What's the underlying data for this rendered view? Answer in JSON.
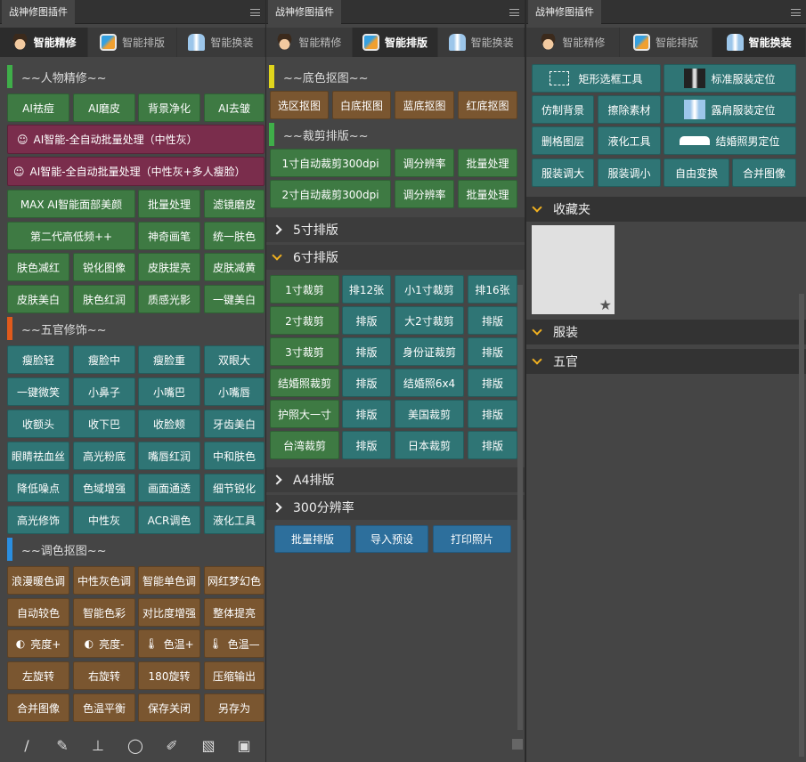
{
  "panel_title": "战神修图插件",
  "tabs": [
    "智能精修",
    "智能排版",
    "智能换装"
  ],
  "p1": {
    "sec1": "~~人物精修~~",
    "row1": [
      "AI祛痘",
      "AI磨皮",
      "背景净化",
      "AI去皱"
    ],
    "ai1": "AI智能-全自动批量处理（中性灰）",
    "ai2": "AI智能-全自动批量处理（中性灰+多人瘦脸）",
    "row2": [
      "MAX AI智能面部美颜",
      "批量处理",
      "滤镜磨皮"
    ],
    "row3": [
      "第二代高低频++",
      "神奇画笔",
      "统一肤色"
    ],
    "row4": [
      "肤色减红",
      "锐化图像",
      "皮肤提亮",
      "皮肤减黄"
    ],
    "row5": [
      "皮肤美白",
      "肤色红润",
      "质感光影",
      "一键美白"
    ],
    "sec2": "~~五官修饰~~",
    "f1": [
      "瘦脸轻",
      "瘦脸中",
      "瘦脸重",
      "双眼大"
    ],
    "f2": [
      "一键微笑",
      "小鼻子",
      "小嘴巴",
      "小嘴唇"
    ],
    "f3": [
      "收额头",
      "收下巴",
      "收脸颊",
      "牙齿美白"
    ],
    "f4": [
      "眼睛祛血丝",
      "高光粉底",
      "嘴唇红润",
      "中和肤色"
    ],
    "f5": [
      "降低噪点",
      "色域增强",
      "画面通透",
      "细节锐化"
    ],
    "f6": [
      "高光修饰",
      "中性灰",
      "ACR调色",
      "液化工具"
    ],
    "sec3": "~~调色抠图~~",
    "c1": [
      "浪漫暖色调",
      "中性灰色调",
      "智能单色调",
      "网红梦幻色"
    ],
    "c2": [
      "自动较色",
      "智能色彩",
      "对比度增强",
      "整体提亮"
    ],
    "c3": [
      "亮度+",
      "亮度-",
      "色温+",
      "色温—"
    ],
    "c4": [
      "左旋转",
      "右旋转",
      "180旋转",
      "压缩输出"
    ],
    "c5": [
      "合并图像",
      "色温平衡",
      "保存关闭",
      "另存为"
    ],
    "tools": [
      "brush-icon",
      "mixer-brush-icon",
      "stamp-icon",
      "lasso-icon",
      "healing-brush-icon",
      "bandage-icon",
      "chip-icon"
    ]
  },
  "p2": {
    "sec1": "~~底色抠图~~",
    "bg": [
      "选区抠图",
      "白底抠图",
      "蓝底抠图",
      "红底抠图"
    ],
    "sec2": "~~裁剪排版~~",
    "cr1": [
      "1寸自动裁剪300dpi",
      "调分辨率",
      "批量处理"
    ],
    "cr2": [
      "2寸自动裁剪300dpi",
      "调分辨率",
      "批量处理"
    ],
    "h5": "5寸排版",
    "h6": "6寸排版",
    "g": [
      [
        "1寸裁剪",
        "排12张",
        "小1寸裁剪",
        "排16张"
      ],
      [
        "2寸裁剪",
        "排版",
        "大2寸裁剪",
        "排版"
      ],
      [
        "3寸裁剪",
        "排版",
        "身份证裁剪",
        "排版"
      ],
      [
        "结婚照裁剪",
        "排版",
        "结婚照6x4",
        "排版"
      ],
      [
        "护照大一寸",
        "排版",
        "美国裁剪",
        "排版"
      ],
      [
        "台湾裁剪",
        "排版",
        "日本裁剪",
        "排版"
      ]
    ],
    "hA4": "A4排版",
    "h300": "300分辨率",
    "actions": [
      "批量排版",
      "导入预设",
      "打印照片"
    ]
  },
  "p3": {
    "r1": [
      "矩形选框工具",
      "标准服装定位"
    ],
    "r2": [
      "仿制背景",
      "擦除素材",
      "露肩服装定位"
    ],
    "r3": [
      "删格图层",
      "液化工具",
      "结婚照男定位"
    ],
    "r4": [
      "服装调大",
      "服装调小",
      "自由变换",
      "合并图像"
    ],
    "fav": "收藏夹",
    "clothes": "服装",
    "features": "五官"
  },
  "colors": {
    "green": "#3e7a43",
    "teal": "#2f7575",
    "brown": "#7a5630",
    "magenta": "#7a2d4c",
    "blue": "#2d6f9c",
    "bar_green": "#3fae49",
    "bar_orange": "#e05a1c",
    "bar_blue": "#2a8ee0",
    "bar_yellow": "#e0d51c",
    "chevron": "#f0b020"
  }
}
